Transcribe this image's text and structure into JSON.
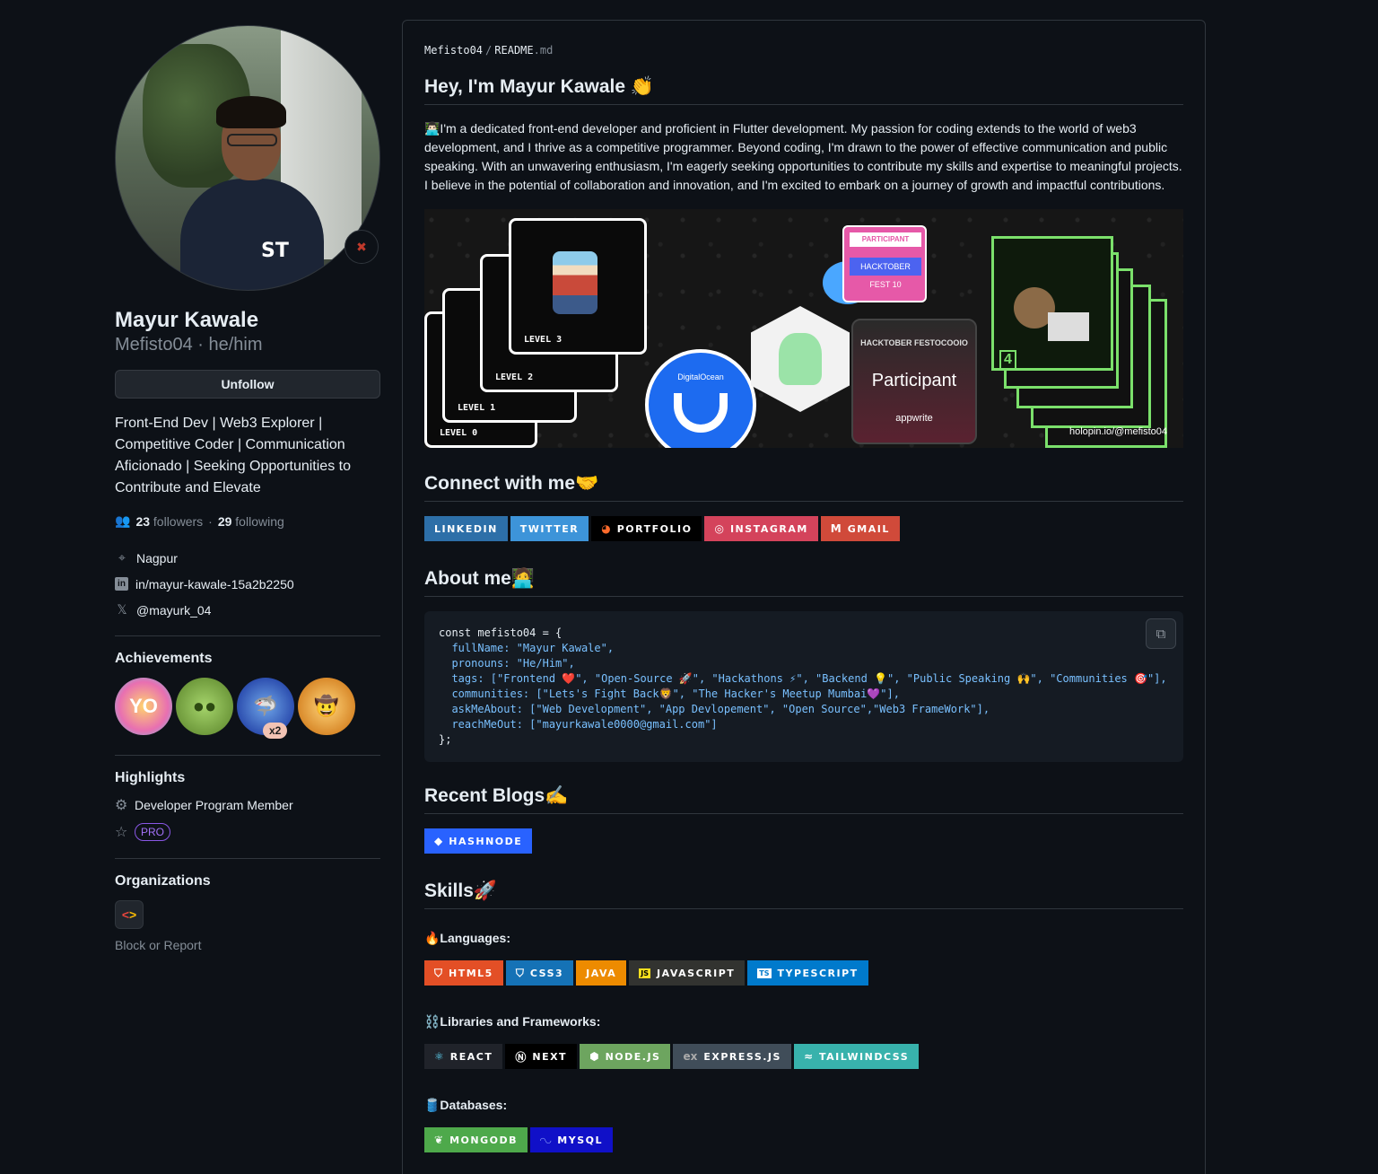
{
  "profile": {
    "name": "Mayur Kawale",
    "login_pronouns": "Mefisto04 · he/him",
    "follow_button": "Unfollow",
    "bio": "Front-End Dev | Web3 Explorer | Competitive Coder | Communication Aficionado | Seeking Opportunities to Contribute and Elevate",
    "followers_count": "23",
    "followers_label": "followers",
    "following_count": "29",
    "following_label": "following",
    "location": "Nagpur",
    "linkedin": "in/mayur-kawale-15a2b2250",
    "twitter": "@mayurk_04",
    "avatar_logo": "ST"
  },
  "achievements": {
    "title": "Achievements",
    "items": [
      {
        "icon": "yolo-badge-icon",
        "glyph": "YO"
      },
      {
        "icon": "pair-extraordinaire-icon",
        "glyph": "●●"
      },
      {
        "icon": "pull-shark-icon",
        "glyph": "🦈",
        "count": "x2"
      },
      {
        "icon": "quickdraw-icon",
        "glyph": "🤠"
      }
    ]
  },
  "highlights": {
    "title": "Highlights",
    "developer_program": "Developer Program Member",
    "pro": "PRO"
  },
  "organizations": {
    "title": "Organizations",
    "block": "Block or Report"
  },
  "readme": {
    "crumb_user": "Mefisto04",
    "crumb_sep": "/",
    "crumb_file": "README",
    "crumb_ext": ".md",
    "heading": "Hey, I'm Mayur Kawale 👏",
    "intro": "👨🏻‍💻I'm a dedicated front-end developer and proficient in Flutter development. My passion for coding extends to the world of web3 development, and I thrive as a competitive programmer. Beyond coding, I'm drawn to the power of effective communication and public speaking. With an unwavering enthusiasm, I'm eagerly seeking opportunities to contribute my skills and expertise to meaningful projects. I believe in the potential of collaboration and innovation, and I'm excited to embark on a journey of growth and impactful contributions.",
    "banner": {
      "levels": [
        "LEVEL 0",
        "LEVEL 1",
        "LEVEL 2",
        "LEVEL 3"
      ],
      "digitalocean": "DigitalOcean",
      "participant": "Participant",
      "hacktober_fest": "HACKTOBER FESTOCOOIO",
      "appwrite": "appwrite",
      "participant_top": "PARTICIPANT",
      "hacktober_card": "HACKTOBER FEST 10",
      "holopin": "holopin.io/@mefisto04"
    },
    "connect_heading": "Connect with me🤝",
    "connect_badges": [
      {
        "label": "LINKEDIN",
        "color": "#2d6fa8",
        "icon": ""
      },
      {
        "label": "TWITTER",
        "color": "#3d94d9",
        "icon": ""
      },
      {
        "label": "PORTFOLIO",
        "color": "#000000",
        "icon": "portfolio-icon"
      },
      {
        "label": "INSTAGRAM",
        "color": "#d4435b",
        "icon": "instagram-icon"
      },
      {
        "label": "GMAIL",
        "color": "#d04a3a",
        "icon": "gmail-icon"
      }
    ],
    "about_heading": "About me🧑‍💻",
    "code_lines": [
      "const mefisto04 = {",
      "  fullName: \"Mayur Kawale\",",
      "  pronouns: \"He/Him\",",
      "  tags: [\"Frontend ❤️\", \"Open-Source 🚀\", \"Hackathons ⚡\", \"Backend 💡\", \"Public Speaking 🙌\", \"Communities 🎯\"],",
      "  communities: [\"Lets's Fight Back🦁\", \"The Hacker's Meetup Mumbai💜\"],",
      "  askMeAbout: [\"Web Development\", \"App Devlopement\", \"Open Source\",\"Web3 FrameWork\"],",
      "  reachMeOut: [\"mayurkawale0000@gmail.com\"]",
      "};"
    ],
    "blogs_heading": "Recent Blogs✍️",
    "hashnode": "HASHNODE",
    "skills_heading": "Skills🚀",
    "languages_label": "🔥Languages:",
    "languages": [
      {
        "label": "HTML5",
        "color": "#e34f26",
        "icon": "html5-icon"
      },
      {
        "label": "CSS3",
        "color": "#1572b6",
        "icon": "css3-icon"
      },
      {
        "label": "JAVA",
        "color": "#ed8b00",
        "icon": ""
      },
      {
        "label": "JAVASCRIPT",
        "color": "#323330",
        "icon": "javascript-icon"
      },
      {
        "label": "TYPESCRIPT",
        "color": "#007acc",
        "icon": "typescript-icon"
      }
    ],
    "libraries_label": "⛓️Libraries and Frameworks:",
    "libraries": [
      {
        "label": "REACT",
        "color": "#20232a",
        "icon": "react-icon"
      },
      {
        "label": "NEXT",
        "color": "#000000",
        "icon": "next-icon"
      },
      {
        "label": "NODE.JS",
        "color": "#6da55f",
        "icon": "node-icon"
      },
      {
        "label": "EXPRESS.JS",
        "color": "#404d59",
        "icon": "express-icon"
      },
      {
        "label": "TAILWINDCSS",
        "color": "#38b2ac",
        "icon": "tailwind-icon"
      }
    ],
    "databases_label": "🛢️Databases:",
    "databases": [
      {
        "label": "MONGODB",
        "color": "#4ea94b",
        "icon": "mongodb-icon"
      },
      {
        "label": "MYSQL",
        "color": "#00000f",
        "icon": "mysql-icon"
      }
    ]
  }
}
